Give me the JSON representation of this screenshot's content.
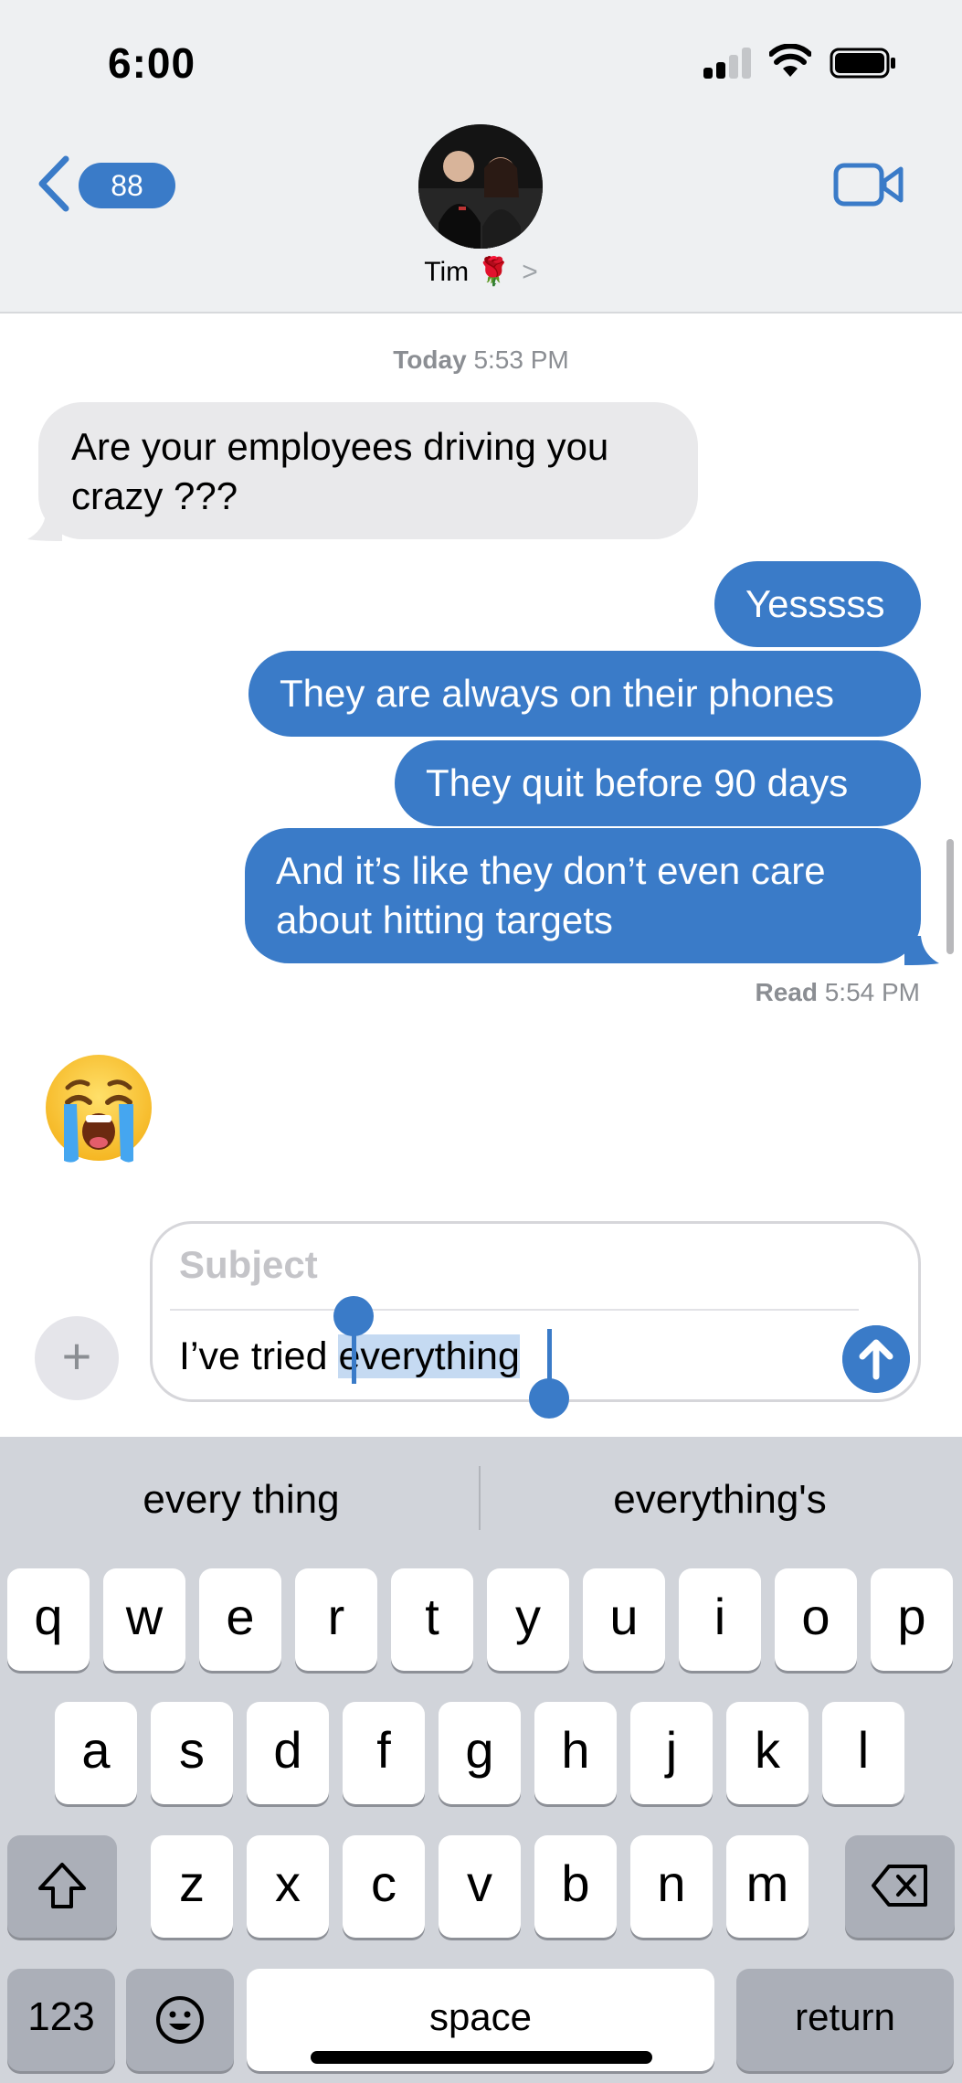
{
  "status_bar": {
    "time": "6:00"
  },
  "nav": {
    "back_count": "88",
    "contact_name": "Tim",
    "contact_emoji": "🌹",
    "chevron": ">"
  },
  "thread": {
    "timestamp_day": "Today",
    "timestamp_time": "5:53 PM",
    "messages": [
      {
        "direction": "incoming",
        "text": "Are your employees driving you crazy ???"
      },
      {
        "direction": "outgoing",
        "text": "Yesssss"
      },
      {
        "direction": "outgoing",
        "text": "They are always on their phones"
      },
      {
        "direction": "outgoing",
        "text": "They quit before 90 days"
      },
      {
        "direction": "outgoing",
        "text": "And it’s like they don’t even care about hitting targets"
      }
    ],
    "read_label": "Read",
    "read_time": "5:54 PM",
    "reaction_emoji": "crying-face"
  },
  "composer": {
    "subject_placeholder": "Subject",
    "text_before": "I’ve tried ",
    "text_selected": "everything",
    "plus": "+"
  },
  "keyboard": {
    "suggestions": [
      "every thing",
      "everything's"
    ],
    "row1": [
      "q",
      "w",
      "e",
      "r",
      "t",
      "y",
      "u",
      "i",
      "o",
      "p"
    ],
    "row2": [
      "a",
      "s",
      "d",
      "f",
      "g",
      "h",
      "j",
      "k",
      "l"
    ],
    "row3": [
      "z",
      "x",
      "c",
      "v",
      "b",
      "n",
      "m"
    ],
    "numbers_label": "123",
    "space_label": "space",
    "return_label": "return"
  },
  "colors": {
    "accent": "#3a7bc8",
    "incoming_bubble": "#e9e9eb",
    "keyboard_bg": "#d1d4da"
  }
}
